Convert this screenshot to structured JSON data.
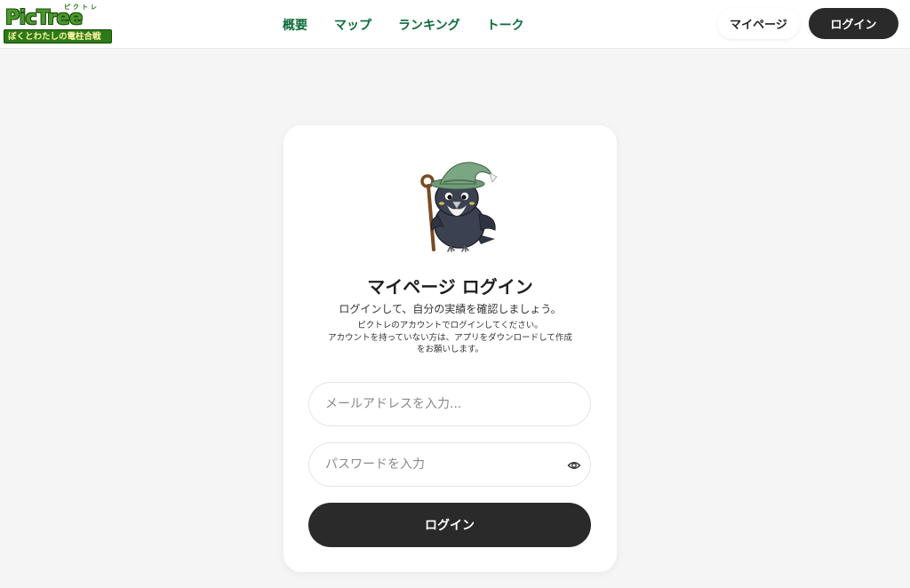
{
  "header": {
    "logo": {
      "title": "PicTree",
      "ruby": "ピクトレ",
      "subtitle": "ぼくとわたしの電柱合戦"
    },
    "nav": [
      "概要",
      "マップ",
      "ランキング",
      "トーク"
    ],
    "mypage_label": "マイページ",
    "login_label": "ログイン"
  },
  "card": {
    "mascot_icon": "crow-wizard-mascot-icon",
    "title": "マイページ ログイン",
    "subtitle": "ログインして、自分の実績を確認しましょう。",
    "description_line1": "ピクトレのアカウントでログインしてください。",
    "description_line2": "アカウントを持っていない方は、アプリをダウンロードして作成",
    "description_line3": "をお願いします。",
    "email_placeholder": "メールアドレスを入力...",
    "password_placeholder": "パスワードを入力",
    "password_toggle_icon": "eye-icon",
    "submit_label": "ログイン"
  },
  "colors": {
    "nav_text": "#0d6b3a",
    "dark_button": "#2a2a2a",
    "background": "#f5f5f5"
  }
}
